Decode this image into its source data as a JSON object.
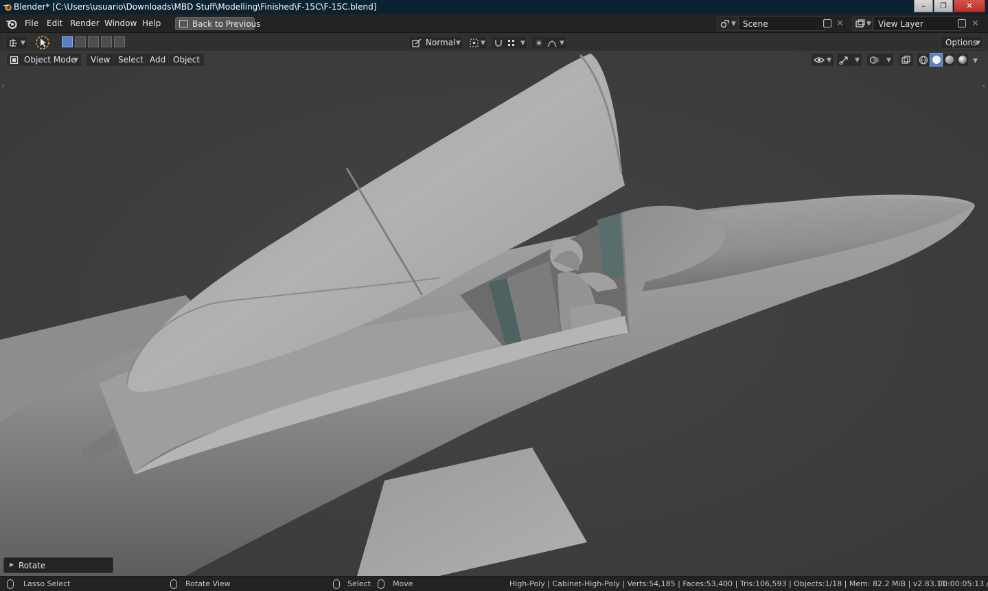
{
  "window": {
    "title": "Blender* [C:\\Users\\usuario\\Downloads\\MBD Stuff\\Modelling\\Finished\\F-15C\\F-15C.blend]",
    "buttons": [
      "minimize",
      "maximize",
      "close"
    ]
  },
  "menubar": {
    "items": [
      "File",
      "Edit",
      "Render",
      "Window",
      "Help"
    ],
    "back_button": "Back to Previous",
    "scene": "Scene",
    "view_layer": "View Layer"
  },
  "toolbar": {
    "orientation": "Normal",
    "options": "Options"
  },
  "viewport_header": {
    "mode": "Object Mode",
    "menus": [
      "View",
      "Select",
      "Add",
      "Object"
    ]
  },
  "viewport": {
    "background_color": "#3d3d3d",
    "model_color": "#9a9a9a",
    "shading_active": "solid"
  },
  "operator_panel": {
    "label": "Rotate"
  },
  "statusbar": {
    "lasso": "Lasso Select",
    "rotate_view": "Rotate View",
    "select": "Select",
    "move": "Move",
    "stats": "High-Poly | Cabinet-High-Poly | Verts:54,185 | Faces:53,400 | Tris:106,593 | Objects:1/18 | Mem: 82.2 MiB | v2.83.11",
    "time": "00:00:05:13 /"
  },
  "colors": {
    "accent": "#5680c2",
    "titlebar": "#0b2233"
  }
}
